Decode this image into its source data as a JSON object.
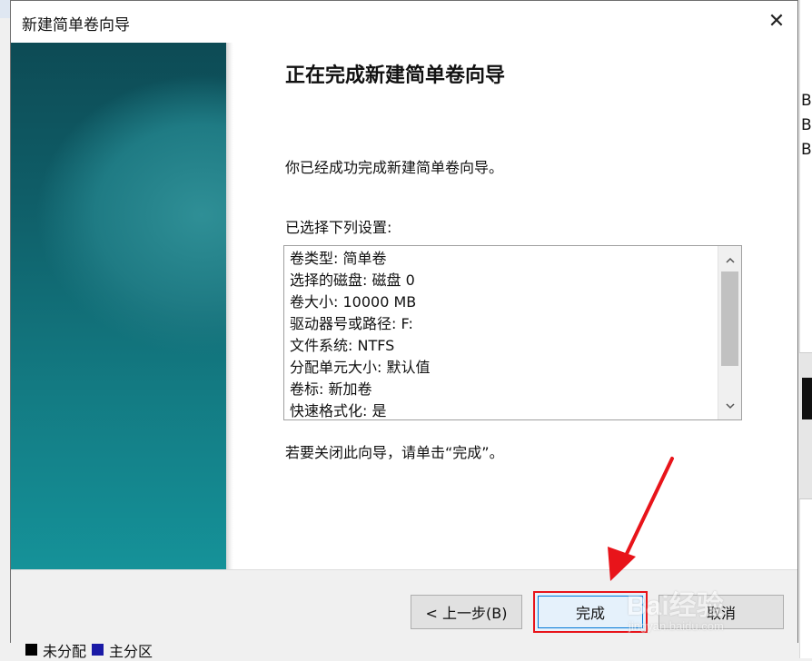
{
  "background": {
    "side_letters": [
      "B",
      "B",
      "B"
    ],
    "legend": [
      {
        "label": "未分配",
        "color": "#000000"
      },
      {
        "label": "主分区",
        "color": "#1a1aa6"
      }
    ]
  },
  "dialog": {
    "title": "新建简单卷向导",
    "close_glyph": "✕",
    "heading": "正在完成新建简单卷向导",
    "success_text": "你已经成功完成新建简单卷向导。",
    "settings_label": "已选择下列设置:",
    "settings": [
      "卷类型: 简单卷",
      "选择的磁盘: 磁盘 0",
      "卷大小: 10000 MB",
      "驱动器号或路径: F:",
      "文件系统: NTFS",
      "分配单元大小: 默认值",
      "卷标: 新加卷",
      "快速格式化: 是"
    ],
    "close_hint": "若要关闭此向导，请单击“完成”。",
    "buttons": {
      "back": "< 上一步(B)",
      "finish": "完成",
      "cancel": "取消"
    }
  },
  "annotation": {
    "arrow_color": "#e8141a",
    "highlight_color": "#e8141a"
  },
  "watermark": {
    "main": "Bai经验",
    "sub": "jingyan.baidu.com"
  },
  "icons": {
    "close": "close-icon",
    "scroll_up": "chevron-up-icon",
    "scroll_down": "chevron-down-icon"
  }
}
